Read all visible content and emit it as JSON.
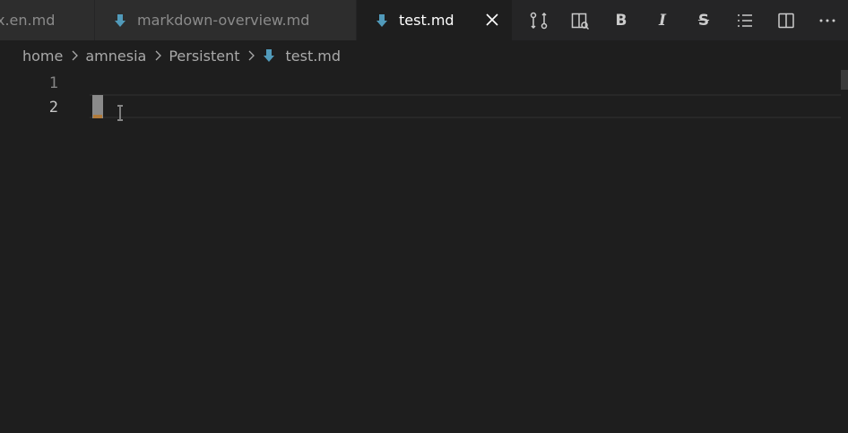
{
  "tabs": [
    {
      "label": "x.en.md",
      "active": false
    },
    {
      "label": "markdown-overview.md",
      "active": false
    },
    {
      "label": "test.md",
      "active": true
    }
  ],
  "editor_actions": [
    {
      "name": "open-changes",
      "icon": "git-compare-icon"
    },
    {
      "name": "open-preview-to-side",
      "icon": "preview-icon"
    },
    {
      "name": "bold",
      "icon": "bold-icon",
      "glyph": "B"
    },
    {
      "name": "italic",
      "icon": "italic-icon",
      "glyph": "I"
    },
    {
      "name": "strikethrough",
      "icon": "strikethrough-icon",
      "glyph": "S"
    },
    {
      "name": "list",
      "icon": "list-icon"
    },
    {
      "name": "split-editor",
      "icon": "split-editor-icon"
    },
    {
      "name": "more-actions",
      "icon": "ellipsis-icon",
      "glyph": "···"
    }
  ],
  "breadcrumb": {
    "items": [
      "home",
      "amnesia",
      "Persistent",
      "test.md"
    ]
  },
  "editor": {
    "line_numbers": [
      "1",
      "2"
    ],
    "active_line": 2,
    "lines": [
      "",
      ""
    ]
  },
  "colors": {
    "background": "#1e1e1e",
    "tab_inactive": "#2d2d2d",
    "tab_bar": "#252526",
    "markdown_icon": "#519aba",
    "text": "#cccccc"
  }
}
